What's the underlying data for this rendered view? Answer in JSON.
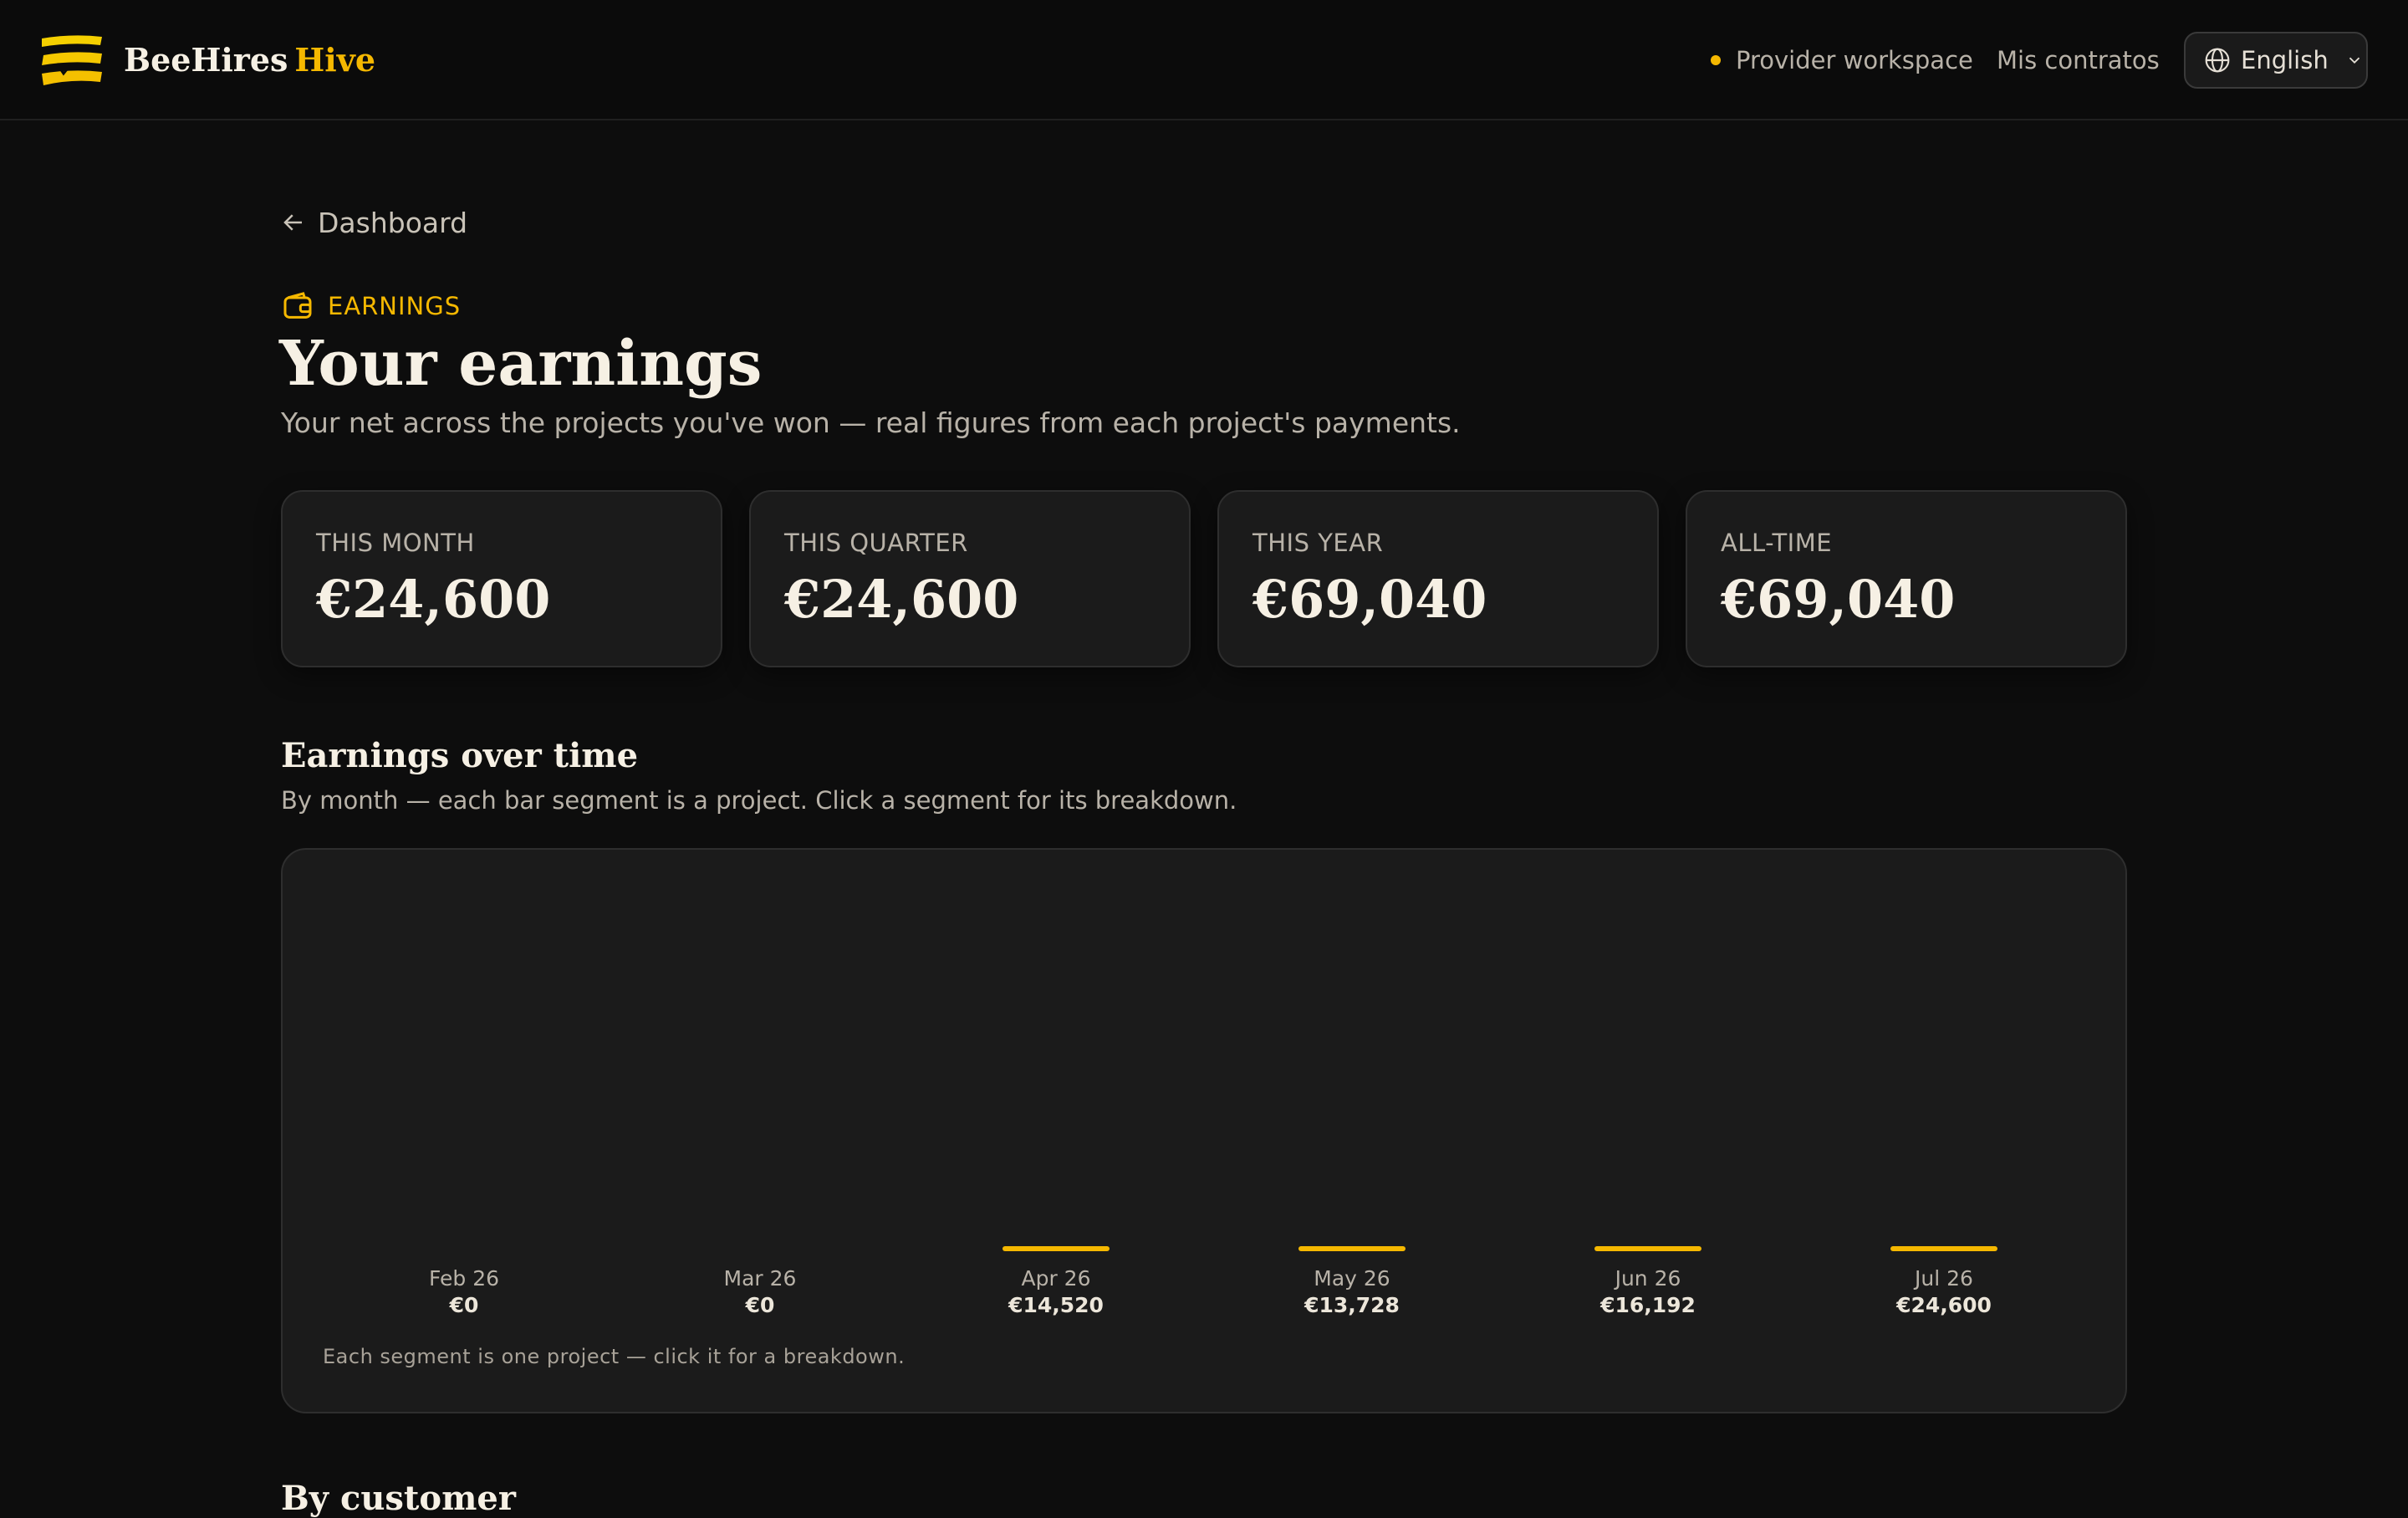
{
  "header": {
    "brand_name": "BeeHires",
    "brand_suffix": "Hive",
    "workspace_label": "Provider workspace",
    "contracts_link": "Mis contratos",
    "language": "English"
  },
  "page": {
    "back_label": "Dashboard",
    "eyebrow": "EARNINGS",
    "title": "Your earnings",
    "subtitle": "Your net across the projects you've won — real figures from each project's payments."
  },
  "stats": [
    {
      "label": "THIS MONTH",
      "value": "€24,600"
    },
    {
      "label": "THIS QUARTER",
      "value": "€24,600"
    },
    {
      "label": "THIS YEAR",
      "value": "€69,040"
    },
    {
      "label": "ALL-TIME",
      "value": "€69,040"
    }
  ],
  "earnings_section": {
    "title": "Earnings over time",
    "subtitle": "By month — each bar segment is a project. Click a segment for its breakdown.",
    "note": "Each segment is one project — click it for a breakdown."
  },
  "chart_data": {
    "type": "bar",
    "categories": [
      "Feb 26",
      "Mar 26",
      "Apr 26",
      "May 26",
      "Jun 26",
      "Jul 26"
    ],
    "values": [
      0,
      0,
      14520,
      13728,
      16192,
      24600
    ],
    "value_labels": [
      "€0",
      "€0",
      "€14,520",
      "€13,728",
      "€16,192",
      "€24,600"
    ],
    "bar_color": "#f5b800",
    "grid": false
  },
  "next_section": {
    "title": "By customer"
  },
  "colors": {
    "accent": "#f5b800",
    "background": "#0d0d0d",
    "card": "#1b1b1b"
  }
}
